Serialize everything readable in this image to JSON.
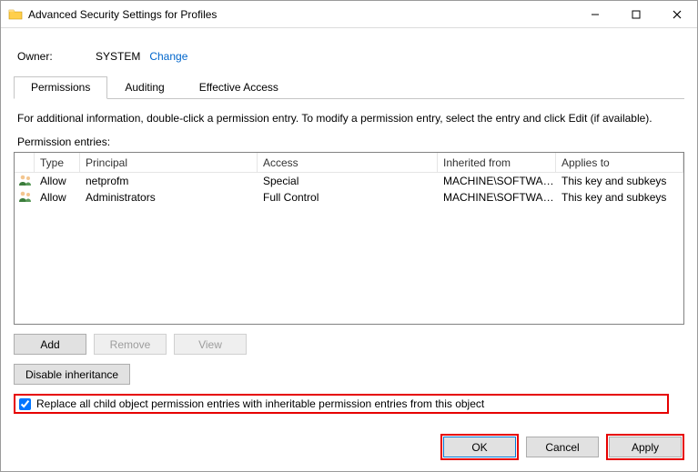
{
  "window": {
    "title": "Advanced Security Settings for Profiles"
  },
  "owner": {
    "label": "Owner:",
    "value": "SYSTEM",
    "change": "Change"
  },
  "tabs": {
    "permissions": "Permissions",
    "auditing": "Auditing",
    "effective": "Effective Access"
  },
  "info_text": "For additional information, double-click a permission entry. To modify a permission entry, select the entry and click Edit (if available).",
  "entries_label": "Permission entries:",
  "columns": {
    "type": "Type",
    "principal": "Principal",
    "access": "Access",
    "inherited": "Inherited from",
    "applies": "Applies to"
  },
  "rows": [
    {
      "type": "Allow",
      "principal": "netprofm",
      "access": "Special",
      "inherited": "MACHINE\\SOFTWARE...",
      "applies": "This key and subkeys"
    },
    {
      "type": "Allow",
      "principal": "Administrators",
      "access": "Full Control",
      "inherited": "MACHINE\\SOFTWARE...",
      "applies": "This key and subkeys"
    }
  ],
  "buttons": {
    "add": "Add",
    "remove": "Remove",
    "view": "View",
    "disable_inheritance": "Disable inheritance",
    "ok": "OK",
    "cancel": "Cancel",
    "apply": "Apply"
  },
  "replace_label": "Replace all child object permission entries with inheritable permission entries from this object",
  "replace_checked": true
}
